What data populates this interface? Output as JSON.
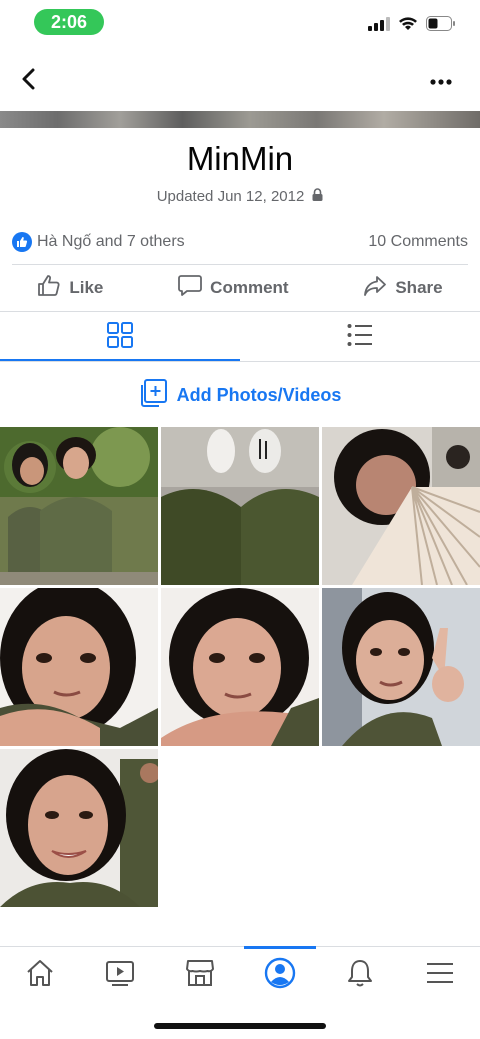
{
  "status_bar": {
    "time": "2:06",
    "icons": [
      "signal-icon",
      "wifi-icon",
      "battery-icon"
    ]
  },
  "nav": {
    "back_icon": "chevron-left-icon",
    "more_icon": "more-icon"
  },
  "album": {
    "title": "MinMin",
    "updated": "Updated Jun 12, 2012",
    "privacy_icon": "lock-icon"
  },
  "reactions": {
    "text": "Hà Ngố and 7 others",
    "comments": "10 Comments"
  },
  "actions": {
    "like": "Like",
    "comment": "Comment",
    "share": "Share"
  },
  "view_tabs": {
    "active": "grid",
    "items": [
      "grid-view-icon",
      "list-view-icon"
    ]
  },
  "add_media": {
    "label": "Add Photos/Videos"
  },
  "photos": [
    {
      "desc": "two-friends-uniform"
    },
    {
      "desc": "feet-sneakers"
    },
    {
      "desc": "fan-selfie"
    },
    {
      "desc": "selfie-1"
    },
    {
      "desc": "selfie-2"
    },
    {
      "desc": "selfie-peace"
    },
    {
      "desc": "selfie-smile"
    }
  ],
  "bottom_nav": {
    "active": "profile",
    "items": [
      "home-icon",
      "watch-icon",
      "marketplace-icon",
      "profile-icon",
      "notifications-icon",
      "menu-icon"
    ]
  },
  "colors": {
    "accent": "#1877f2",
    "status_green": "#34c759",
    "secondary_text": "#65676b",
    "divider": "#dadde1"
  }
}
